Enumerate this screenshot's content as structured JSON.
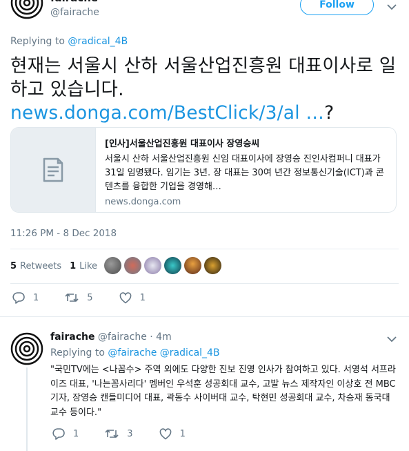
{
  "main_tweet": {
    "display_name": "fairache",
    "handle": "@fairache",
    "follow_label": "Follow",
    "replying_prefix": "Replying to",
    "replying_to": "@radical_4B",
    "text": "현재는 서울시 산하 서울산업진흥원 대표이사로 일하고 있습니다.",
    "link_text": "news.donga.com/BestClick/3/al …",
    "trailing": "?",
    "card": {
      "title": "[인사]서울산업진흥원 대표이사 장영승씨",
      "description": "서울시 산하 서울산업진흥원 신임 대표이사에 장영승 진인사컴퍼니 대표가 31일 임명됐다. 임기는 3년. 장 대표는 30여 년간 정보통신기술(ICT)과 콘텐츠를 융합한 기업을 경영해…",
      "domain": "news.donga.com"
    },
    "timestamp": "11:26 PM - 8 Dec 2018",
    "retweets_count": "5",
    "retweets_label": "Retweets",
    "likes_count": "1",
    "likes_label": "Like",
    "actions": {
      "reply": "1",
      "retweet": "5",
      "like": "1"
    }
  },
  "reply_tweet": {
    "display_name": "fairache",
    "handle": "@fairache",
    "time": "· 4m",
    "replying_prefix": "Replying to",
    "replying_to": "@fairache @radical_4B",
    "text": "\"국민TV에는 <나꼼수> 주역 외에도 다양한 진보 진영 인사가 참여하고 있다. 서영석 서프라이즈 대표, '나는꼼사리다' 멤버인 우석훈 성공회대 교수, 고발 뉴스 제작자인 이상호 전 MBC 기자, 장영승 캔들미디어 대표, 곽동수 사이버대 교수, 탁현민 성공회대 교수, 차승재 동국대 교수 등이다.\"",
    "actions": {
      "reply": "1",
      "retweet": "3",
      "like": "1"
    }
  },
  "colors": {
    "accent": "#1da1f2",
    "link": "#1b95e0",
    "muted": "#657786",
    "text": "#14171a",
    "border": "#e1e8ed"
  },
  "icons": [
    "target-avatar",
    "chevron-down-icon",
    "article-icon",
    "reply-icon",
    "retweet-icon",
    "heart-icon"
  ]
}
